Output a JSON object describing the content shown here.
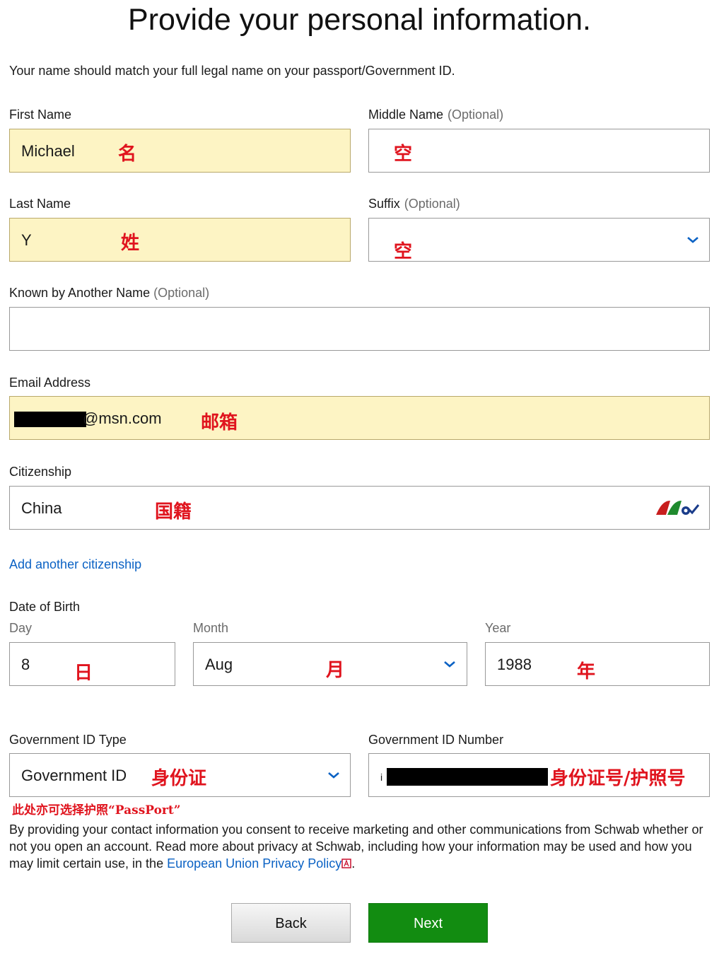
{
  "page": {
    "title": "Provide your personal information.",
    "intro": "Your name should match your full legal name on your passport/Government ID."
  },
  "first_name": {
    "label": "First Name",
    "value": "Michael",
    "annotation": "名"
  },
  "middle_name": {
    "label": "Middle Name",
    "optional": "(Optional)",
    "value": "",
    "annotation": "空"
  },
  "last_name": {
    "label": "Last Name",
    "value": "Y",
    "annotation": "姓"
  },
  "suffix": {
    "label": "Suffix",
    "optional": "(Optional)",
    "value": "",
    "annotation": "空"
  },
  "known_by": {
    "label": "Known by Another Name",
    "optional": "(Optional)",
    "value": ""
  },
  "email": {
    "label": "Email Address",
    "value_suffix": "@msn.com",
    "annotation": "邮箱"
  },
  "citizenship": {
    "label": "Citizenship",
    "value": "China",
    "annotation": "国籍",
    "add_link": "Add another citizenship"
  },
  "dob": {
    "label": "Date of Birth",
    "day": {
      "label": "Day",
      "value": "8",
      "annotation": "日"
    },
    "month": {
      "label": "Month",
      "value": "Aug",
      "annotation": "月"
    },
    "year": {
      "label": "Year",
      "value": "1988",
      "annotation": "年"
    }
  },
  "gov_id_type": {
    "label": "Government ID Type",
    "value": "Government ID",
    "annotation": "身份证",
    "note": "此处亦可选择护照“PassPort”"
  },
  "gov_id_number": {
    "label": "Government ID Number",
    "value_prefix": "i",
    "annotation": "身份证号/护照号"
  },
  "consent": {
    "text": "By providing your contact information you consent to receive marketing and other communications from Schwab whether or not you open an account. Read more about privacy at Schwab, including how your information may be used and how you may limit certain use, in the",
    "link": "European Union Privacy Policy",
    "end": "."
  },
  "buttons": {
    "back": "Back",
    "next": "Next"
  },
  "colors": {
    "filled_bg": "#fdf4c4",
    "link": "#0b62c4",
    "next_bg": "#128c11",
    "annotation": "#e0141e"
  },
  "icons": [
    "chevron-down-icon",
    "pdf-icon",
    "autofill-check-icon"
  ]
}
